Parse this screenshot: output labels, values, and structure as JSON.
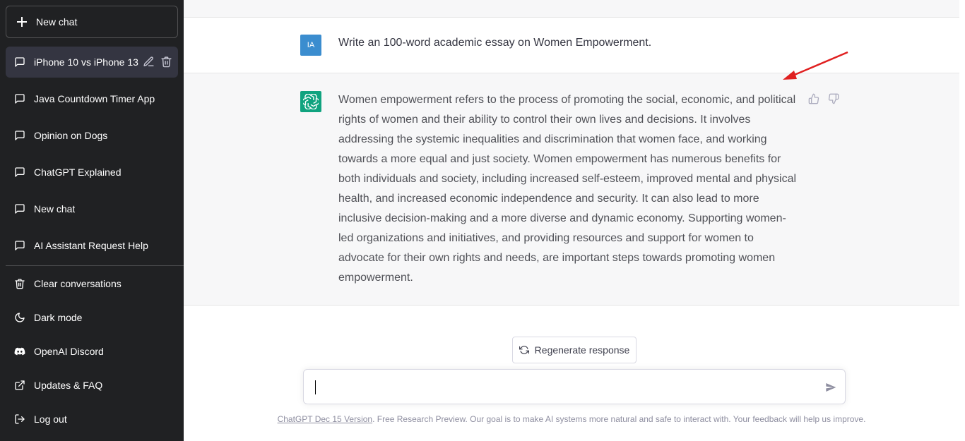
{
  "sidebar": {
    "new_chat_label": "New chat",
    "chats": [
      {
        "label": "iPhone 10 vs iPhone 13",
        "active": true
      },
      {
        "label": "Java Countdown Timer App"
      },
      {
        "label": "Opinion on Dogs"
      },
      {
        "label": "ChatGPT Explained"
      },
      {
        "label": "New chat"
      },
      {
        "label": "AI Assistant Request Help"
      }
    ],
    "menu": [
      {
        "label": "Clear conversations",
        "icon": "trash-icon"
      },
      {
        "label": "Dark mode",
        "icon": "moon-icon"
      },
      {
        "label": "OpenAI Discord",
        "icon": "discord-icon"
      },
      {
        "label": "Updates & FAQ",
        "icon": "external-link-icon"
      },
      {
        "label": "Log out",
        "icon": "logout-icon"
      }
    ]
  },
  "conversation": {
    "user_avatar": "IA",
    "user_message": "Write an 100-word academic essay on Women Empowerment.",
    "ai_message": "Women empowerment refers to the process of promoting the social, economic, and political rights of women and their ability to control their own lives and decisions. It involves addressing the systemic inequalities and discrimination that women face, and working towards a more equal and just society. Women empowerment has numerous benefits for both individuals and society, including increased self-esteem, improved mental and physical health, and increased economic independence and security. It can also lead to more inclusive decision-making and a more diverse and dynamic economy. Supporting women-led organizations and initiatives, and providing resources and support for women to advocate for their own rights and needs, are important steps towards promoting women empowerment."
  },
  "composer": {
    "regenerate_label": "Regenerate response",
    "input_value": ""
  },
  "footer": {
    "version_link": "ChatGPT Dec 15 Version",
    "text": ". Free Research Preview. Our goal is to make AI systems more natural and safe to interact with. Your feedback will help us improve."
  },
  "colors": {
    "sidebar_bg": "#202123",
    "active_chat_bg": "#343541",
    "user_avatar_bg": "#3b8dcf",
    "ai_avatar_bg": "#10a37f",
    "annotation_arrow": "#e02020"
  }
}
